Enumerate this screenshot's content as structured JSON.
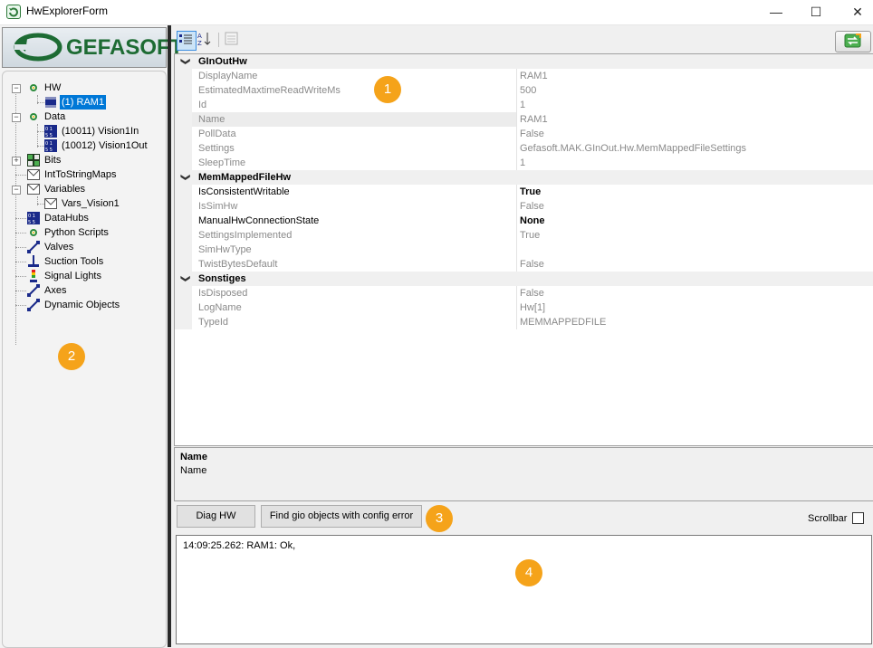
{
  "window": {
    "title": "HwExplorerForm",
    "minimize_glyph": "—",
    "maximize_glyph": "☐",
    "close_glyph": "✕"
  },
  "logo": {
    "text": "GEFASOFT",
    "brand_color": "#1d6b33"
  },
  "tree": {
    "hw": "HW",
    "ram1": "(1) RAM1",
    "data": "Data",
    "vision1in": "(10011) Vision1In",
    "vision1out": "(10012) Vision1Out",
    "bits": "Bits",
    "inttostringmaps": "IntToStringMaps",
    "variables": "Variables",
    "vars_vision1": "Vars_Vision1",
    "datahubs": "DataHubs",
    "python_scripts": "Python Scripts",
    "valves": "Valves",
    "suction_tools": "Suction Tools",
    "signal_lights": "Signal Lights",
    "axes": "Axes",
    "dynamic_objects": "Dynamic Objects"
  },
  "propgrid": {
    "categories": {
      "ginouthw": "GInOutHw",
      "memmappedfilehw": "MemMappedFileHw",
      "sonstiges": "Sonstiges"
    },
    "ginouthw": {
      "displayname": {
        "name": "DisplayName",
        "value": "RAM1"
      },
      "estimatedmaxtime": {
        "name": "EstimatedMaxtimeReadWriteMs",
        "value": "500"
      },
      "id": {
        "name": "Id",
        "value": "1"
      },
      "name": {
        "name": "Name",
        "value": "RAM1"
      },
      "polldata": {
        "name": "PollData",
        "value": "False"
      },
      "settings": {
        "name": "Settings",
        "value": "Gefasoft.MAK.GInOut.Hw.MemMappedFileSettings"
      },
      "sleeptime": {
        "name": "SleepTime",
        "value": "1"
      }
    },
    "memmappedfilehw": {
      "isconsistentwritable": {
        "name": "IsConsistentWritable",
        "value": "True"
      },
      "issimhw": {
        "name": "IsSimHw",
        "value": "False"
      },
      "manualhwconnectionstate": {
        "name": "ManualHwConnectionState",
        "value": "None"
      },
      "settingsimplemented": {
        "name": "SettingsImplemented",
        "value": "True"
      },
      "simhwtype": {
        "name": "SimHwType",
        "value": ""
      },
      "twistbytesdefault": {
        "name": "TwistBytesDefault",
        "value": "False"
      }
    },
    "sonstiges": {
      "isdisposed": {
        "name": "IsDisposed",
        "value": "False"
      },
      "logname": {
        "name": "LogName",
        "value": "Hw[1]"
      },
      "typeid": {
        "name": "TypeId",
        "value": "MEMMAPPEDFILE"
      }
    }
  },
  "description": {
    "title": "Name",
    "text": "Name"
  },
  "buttons": {
    "diag_hw": "Diag HW",
    "find_gio": "Find gio objects with config error"
  },
  "scrollbar_label": "Scrollbar",
  "log": {
    "line": "14:09:25.262: RAM1: Ok,"
  },
  "markers": {
    "m1": "1",
    "m2": "2",
    "m3": "3",
    "m4": "4"
  },
  "colors": {
    "marker": "#f5a31a",
    "selection": "#0078d7"
  }
}
